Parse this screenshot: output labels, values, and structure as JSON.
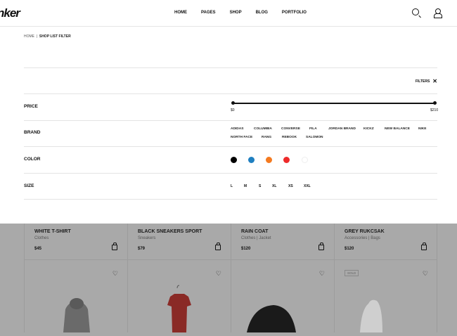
{
  "header": {
    "logo": "nker",
    "nav": [
      "HOME",
      "PAGES",
      "SHOP",
      "BLOG",
      "PORTFOLIO"
    ]
  },
  "breadcrumb": {
    "home": "HOME",
    "current": "SHOP LIST FILTER"
  },
  "filters": {
    "label": "FILTERS",
    "close": "✕",
    "price": {
      "label": "PRICE",
      "min": "$0",
      "max": "$210"
    },
    "brand": {
      "label": "BRAND",
      "items": [
        "ADIDAS",
        "COLUMBIA",
        "CONVERSE",
        "FILA",
        "JORDAN BRAND",
        "KICKZ",
        "NEW BALANCE",
        "NIKE",
        "NORTH FACE",
        "RANG",
        "REBOOK",
        "SALOMON"
      ]
    },
    "color": {
      "label": "COLOR",
      "swatches": [
        "#000000",
        "#1f7fc0",
        "#f47a20",
        "#ee2a2a",
        "#ffffff"
      ]
    },
    "size": {
      "label": "SIZE",
      "items": [
        "L",
        "M",
        "S",
        "XL",
        "XS",
        "XXL"
      ]
    }
  },
  "products": [
    {
      "name": "WHITE T-SHIRT",
      "category": "Clothes",
      "price": "$45"
    },
    {
      "name": "BLACK SNEAKERS SPORT",
      "category": "Sneakers",
      "price": "$79"
    },
    {
      "name": "RAIN COAT",
      "category": "Clothes  |  Jacket",
      "price": "$120"
    },
    {
      "name": "GREY RUKCSAK",
      "category": "Accessories  |  Bags",
      "price": "$120"
    }
  ],
  "second_row": {
    "badge": "SOLD"
  }
}
